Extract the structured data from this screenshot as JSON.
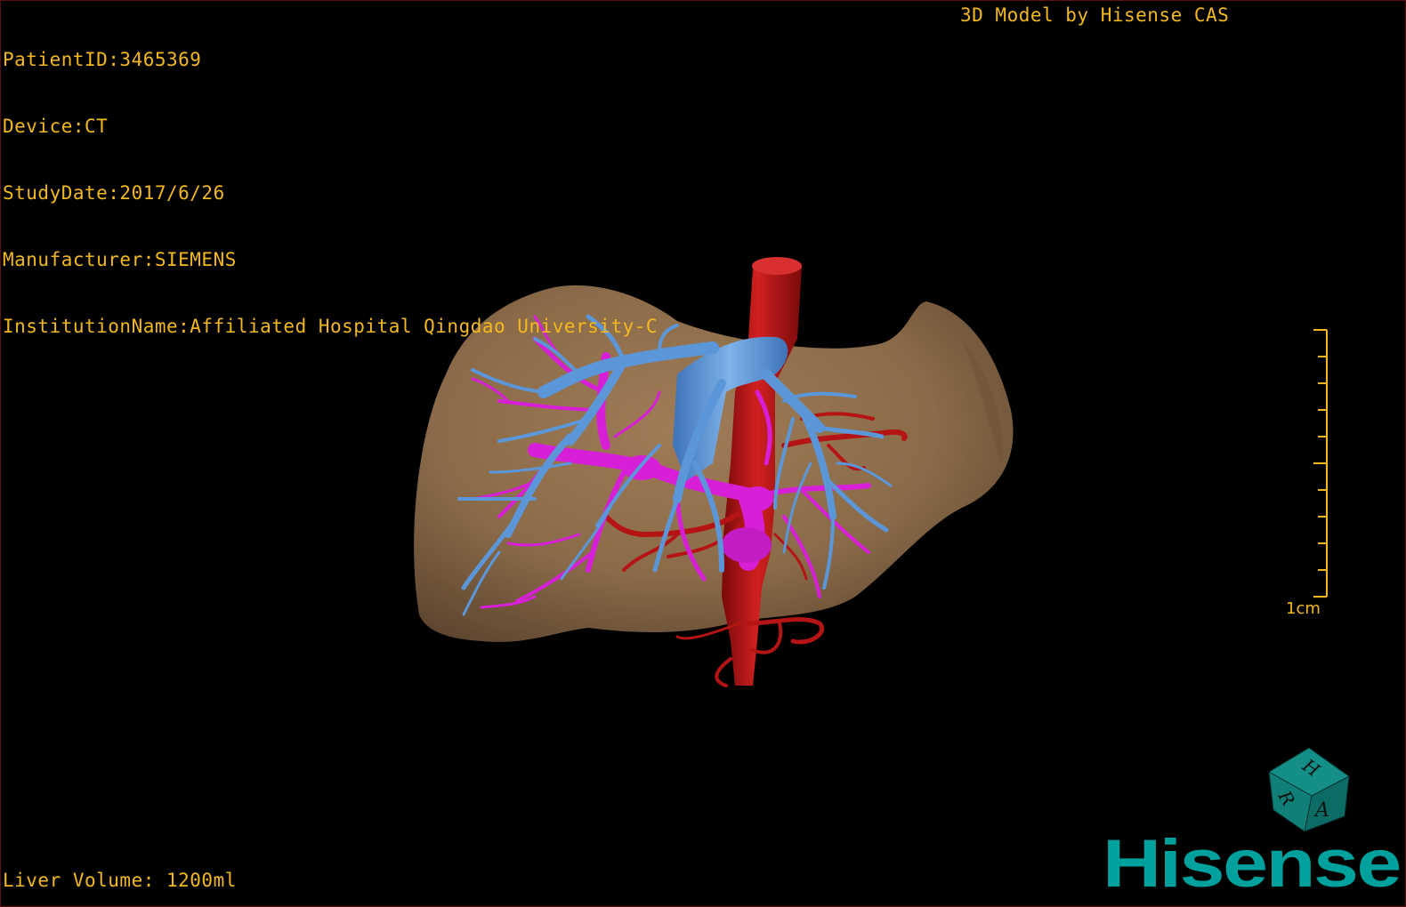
{
  "study_info": {
    "patient_id": "PatientID:3465369",
    "device": "Device:CT",
    "study_date": "StudyDate:2017/6/26",
    "manufacturer": "Manufacturer:SIEMENS",
    "institution": "InstitutionName:Affiliated Hospital Qingdao University-C"
  },
  "model_credit": "3D Model by Hisense CAS",
  "liver_volume": "Liver Volume: 1200ml",
  "scale_bar": {
    "label": "1cm",
    "color": "#f2b81e"
  },
  "orientation_cube": {
    "letters": [
      "H",
      "R",
      "A"
    ],
    "color": "#0f7f78"
  },
  "brand": {
    "name": "Hisense",
    "color": "#00a19c"
  },
  "colors": {
    "overlay_text": "#f2b81e",
    "liver": "#8a6a48",
    "hepatic_vein": "#5b97d8",
    "portal_vein": "#d81fd8",
    "artery_ivc": "#b51414",
    "background": "#000000"
  }
}
